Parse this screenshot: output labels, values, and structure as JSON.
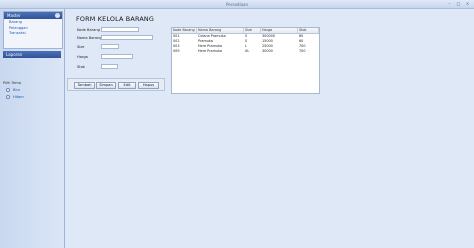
{
  "window": {
    "title": "Persediaan"
  },
  "sidebar": {
    "master_header": "Master",
    "items": [
      "Barang",
      "Pelanggan",
      "Transaksi"
    ],
    "laporan_label": "Laporan",
    "theme_label": "Pilih Tema",
    "themes": [
      "Biru",
      "Hitam"
    ]
  },
  "form": {
    "title": "FORM KELOLA BARANG",
    "fields": {
      "kode": "Kode Barang",
      "nama": "Nama Barang",
      "size": "Size",
      "harga": "Harga",
      "stok": "Stok"
    }
  },
  "buttons": {
    "tambah": "Tambah",
    "simpan": "Simpan",
    "edit": "Edit",
    "hapus": "Hapus"
  },
  "table": {
    "columns": [
      "Kode Barang",
      "Nama Barang",
      "Size",
      "Harga",
      "Stok"
    ],
    "rows": [
      [
        "001",
        "Celana Pramuka",
        "S",
        "300000",
        "60"
      ],
      [
        "002",
        "Pramuka",
        "S",
        "15000",
        "60"
      ],
      [
        "003",
        "Here Pramuka",
        "L",
        "25000",
        "700"
      ],
      [
        "009",
        "Here Pramuka",
        "XL",
        "30000",
        "700"
      ]
    ]
  }
}
